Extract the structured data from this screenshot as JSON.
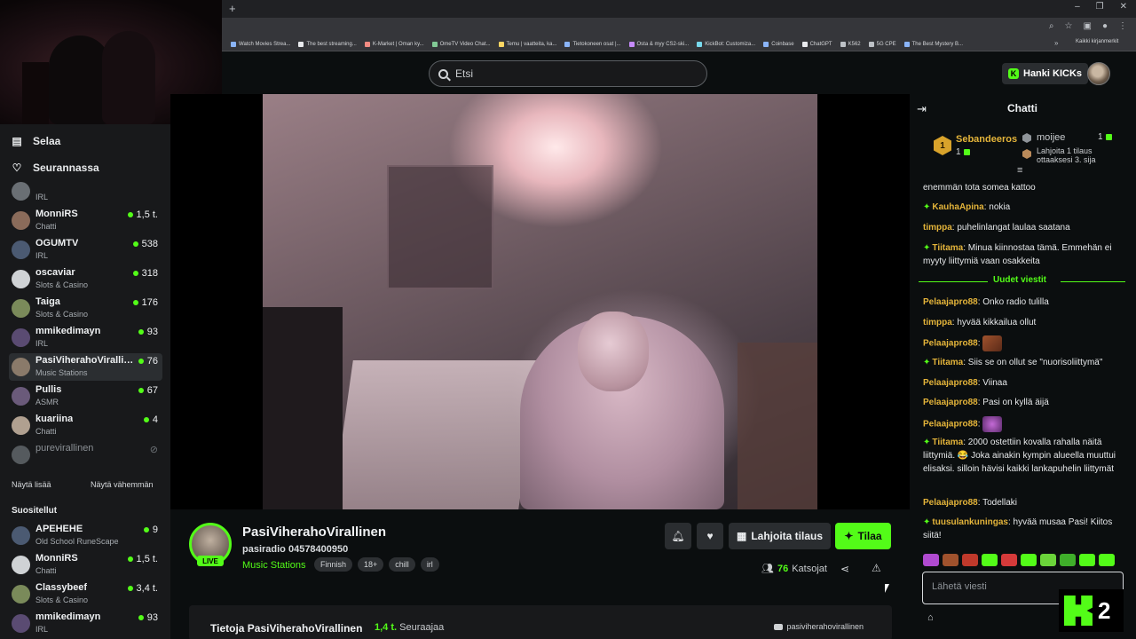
{
  "browser": {
    "new_tab": "+",
    "bookmarks": [
      "Watch Movies Strea...",
      "The best streaming...",
      "K-Market | Oman ky...",
      "OmeTV Video Chat...",
      "Temu | vaatteita, ka...",
      "Tietokoneen osat |...",
      "Osta & myy CS2-ski...",
      "KickBot: Customiza...",
      "Coinbase",
      "ChatGPT",
      "K562",
      "5G CPE",
      "The Best Mystery B..."
    ],
    "bookmarks_more": "»",
    "all_bookmarks": "Kaikki kirjanmerkit"
  },
  "topbar": {
    "search_placeholder": "Etsi",
    "get_kicks": "Hanki KICKs"
  },
  "sidebar": {
    "nav": [
      {
        "label": "Selaa",
        "icon": "browse-icon"
      },
      {
        "label": "Seurannassa",
        "icon": "heart-icon"
      }
    ],
    "following": [
      {
        "name": "",
        "category": "IRL",
        "viewers": ""
      },
      {
        "name": "MonniRS",
        "category": "Chatti",
        "viewers": "1,5 t."
      },
      {
        "name": "OGUMTV",
        "category": "IRL",
        "viewers": "538"
      },
      {
        "name": "oscaviar",
        "category": "Slots & Casino",
        "viewers": "318"
      },
      {
        "name": "Taiga",
        "category": "Slots & Casino",
        "viewers": "176"
      },
      {
        "name": "mmikedimayn",
        "category": "IRL",
        "viewers": "93"
      },
      {
        "name": "PasiViherahoVirallinen",
        "category": "Music Stations",
        "viewers": "76"
      },
      {
        "name": "Pullis",
        "category": "ASMR",
        "viewers": "67"
      },
      {
        "name": "kuariina",
        "category": "Chatti",
        "viewers": "4"
      },
      {
        "name": "purevirallinen",
        "category": "",
        "viewers": ""
      }
    ],
    "show_more": "Näytä lisää",
    "show_less": "Näytä vähemmän",
    "recommended_heading": "Suositellut",
    "recommended": [
      {
        "name": "APEHEHE",
        "category": "Old School RuneScape",
        "viewers": "9"
      },
      {
        "name": "MonniRS",
        "category": "Chatti",
        "viewers": "1,5 t."
      },
      {
        "name": "Classybeef",
        "category": "Slots & Casino",
        "viewers": "3,4 t."
      },
      {
        "name": "mmikedimayn",
        "category": "IRL",
        "viewers": "93"
      }
    ]
  },
  "stream": {
    "channel_name": "PasiViherahoVirallinen",
    "title": "pasiradio 04578400950",
    "category": "Music Stations",
    "tags": [
      "Finnish",
      "18+",
      "chill",
      "irl"
    ],
    "live_label": "LIVE",
    "gift_sub": "Lahjoita tilaus",
    "subscribe": "Tilaa",
    "viewers_count": "76",
    "viewers_label": "Katsojat",
    "about_title": "Tietoja PasiViherahoVirallinen",
    "followers_count": "1,4 t.",
    "followers_label": "Seuraajaa",
    "youtube_handle": "pasiviherahovirallinen"
  },
  "chat": {
    "title": "Chatti",
    "leaderboard": {
      "first_rank": "1",
      "first_name": "Sebandeeros",
      "first_count": "1",
      "second_name": "moijee",
      "second_count": "1",
      "gift_text": "Lahjoita 1 tilaus ottaaksesi 3. sija"
    },
    "new_messages": "Uudet viestit",
    "messages": [
      {
        "user": "",
        "text": "enemmän tota somea kattoo",
        "color": "#e6e8ea"
      },
      {
        "user": "KauhaApina",
        "text": "nokia",
        "color": "#e4b43a"
      },
      {
        "user": "timppa",
        "text": "puhelinlangat laulaa saatana",
        "color": "#e4b43a"
      },
      {
        "user": "Tiitama",
        "text": "Minua kiinnostaa tämä. Emmehän ei myyty liittymiä vaan osakkeita",
        "color": "#e4b43a"
      },
      {
        "user": "Pelaajapro88",
        "text": "Onko radio tulilla",
        "color": "#e4b43a"
      },
      {
        "user": "timppa",
        "text": "hyvää kikkailua ollut",
        "color": "#e4b43a"
      },
      {
        "user": "Pelaajapro88",
        "text": "",
        "color": "#e4b43a"
      },
      {
        "user": "Tiitama",
        "text": "Siis se on ollut se \"nuorisoliittymä\"",
        "color": "#e4b43a"
      },
      {
        "user": "Pelaajapro88",
        "text": "Viinaa",
        "color": "#e4b43a"
      },
      {
        "user": "Pelaajapro88",
        "text": "Pasi on kyllä äijä",
        "color": "#e4b43a"
      },
      {
        "user": "Pelaajapro88",
        "text": "",
        "color": "#e4b43a"
      },
      {
        "user": "Tiitama",
        "text": "2000 ostettiin kovalla rahalla näitä liittymiä. 😂 Joka ainakin kympin alueella muuttui elisaksi. silloin hävisi kaikki lankapuhelin liittymät",
        "color": "#e4b43a"
      },
      {
        "user": "Pelaajapro88",
        "text": "Todellaki",
        "color": "#e4b43a"
      },
      {
        "user": "tuusulankuningas",
        "text": "hyvää musaa Pasi! Kiitos siitä!",
        "color": "#e4b43a"
      }
    ],
    "input_placeholder": "Lähetä viesti",
    "overlay_number": "2"
  },
  "colors": {
    "accent": "#53fc18",
    "background": "#0b0e0f",
    "panel": "#18191b",
    "username": "#e4b43a"
  }
}
